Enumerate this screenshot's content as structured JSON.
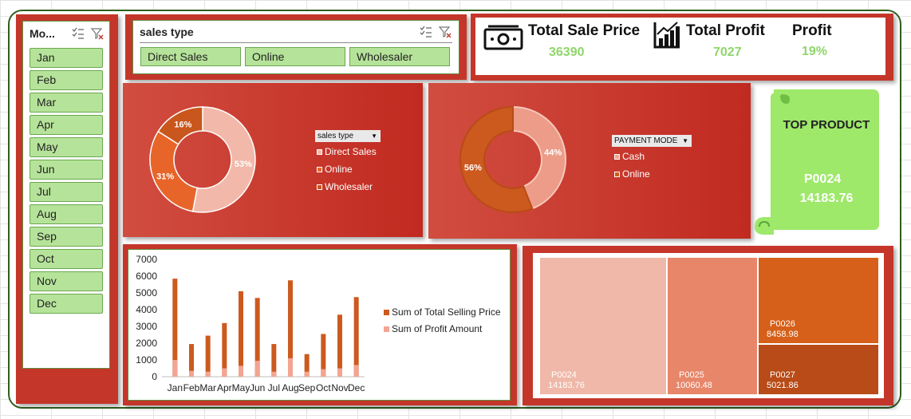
{
  "month_slicer": {
    "title": "Mo...",
    "months": [
      "Jan",
      "Feb",
      "Mar",
      "Apr",
      "May",
      "Jun",
      "Jul",
      "Aug",
      "Sep",
      "Oct",
      "Nov",
      "Dec"
    ]
  },
  "sales_type_slicer": {
    "title": "sales type",
    "options": [
      "Direct Sales",
      "Online",
      "Wholesaler"
    ]
  },
  "kpis": {
    "total_sale_price_label": "Total Sale Price",
    "total_sale_price_value": "36390",
    "total_profit_label": "Total Profit",
    "total_profit_value": "7027",
    "profit_label": "Profit",
    "profit_value": "19%"
  },
  "sales_type_donut": {
    "filter_label": "sales type",
    "legend": [
      "Direct Sales",
      "Online",
      "Wholesaler"
    ],
    "labels": [
      "16%",
      "53%",
      "31%"
    ]
  },
  "payment_donut": {
    "filter_label": "PAYMENT MODE",
    "legend": [
      "Cash",
      "Online"
    ],
    "labels": [
      "44%",
      "56%"
    ]
  },
  "top_product": {
    "title": "TOP PRODUCT",
    "product": "P0024",
    "value": "14183.76"
  },
  "treemap": {
    "cells": [
      {
        "name": "P0024",
        "value": "14183.76"
      },
      {
        "name": "P0025",
        "value": "10060.48"
      },
      {
        "name": "P0026",
        "value": "8458.98"
      },
      {
        "name": "P0027",
        "value": "5021.86"
      }
    ]
  },
  "colors": {
    "panel_red": "#c5362a",
    "slicer_green": "#b6e39a",
    "kpi_green": "#8fd66a",
    "total_selling": "#cc5a1e",
    "profit_amount": "#f2a592"
  },
  "chart_data": [
    {
      "type": "bar",
      "categories": [
        "Jan",
        "Feb",
        "Mar",
        "Apr",
        "May",
        "Jun",
        "Jul",
        "Aug",
        "Sep",
        "Oct",
        "Nov",
        "Dec"
      ],
      "series": [
        {
          "name": "Sum of Total Selling Price",
          "values": [
            5850,
            1950,
            2450,
            3200,
            5100,
            4700,
            1950,
            5750,
            1350,
            2550,
            3700,
            4750
          ]
        },
        {
          "name": "Sum of Profit Amount",
          "values": [
            1000,
            350,
            300,
            500,
            650,
            950,
            300,
            1100,
            300,
            450,
            500,
            700
          ]
        }
      ],
      "yticks": [
        0,
        1000,
        2000,
        3000,
        4000,
        5000,
        6000,
        7000
      ],
      "ylim": [
        0,
        7000
      ],
      "legend_position": "right"
    },
    {
      "type": "pie",
      "categories": [
        "Direct Sales",
        "Online",
        "Wholesaler"
      ],
      "values": [
        53,
        16,
        31
      ],
      "legend_position": "right"
    },
    {
      "type": "pie",
      "categories": [
        "Cash",
        "Online"
      ],
      "values": [
        44,
        56
      ],
      "legend_position": "right"
    }
  ]
}
